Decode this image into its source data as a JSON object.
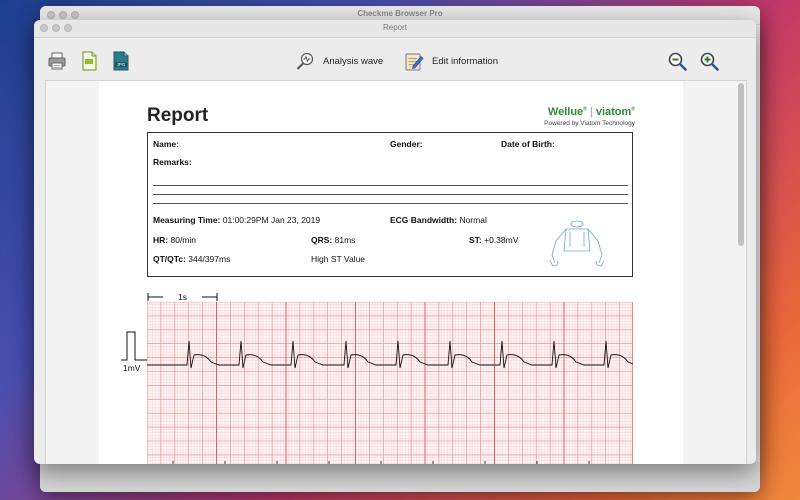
{
  "background_window": {
    "title": "Checkme Browser Pro"
  },
  "window": {
    "title": "Report"
  },
  "toolbar": {
    "print_icon": "printer-icon",
    "pdf_icon": "pdf-file-icon",
    "jpg_icon": "jpg-file-icon",
    "jpg_badge": "JPG",
    "analysis_label": "Analysis wave",
    "edit_label": "Edit information",
    "zoom_out_icon": "zoom-out-icon",
    "zoom_in_icon": "zoom-in-icon"
  },
  "report": {
    "title": "Report",
    "brand": {
      "wellue": "Wellue",
      "separator": "|",
      "viatom": "viatom",
      "powered": "Powered by Viatom Technology"
    },
    "fields": {
      "name_label": "Name:",
      "gender_label": "Gender:",
      "dob_label": "Date of Birth:",
      "remarks_label": "Remarks:",
      "measuring_time_label": "Measuring Time:",
      "measuring_time_value": "01:00:29PM Jan 23, 2019",
      "ecg_bandwidth_label": "ECG Bandwidth:",
      "ecg_bandwidth_value": "Normal",
      "hr_label": "HR:",
      "hr_value": "80/min",
      "qrs_label": "QRS:",
      "qrs_value": "81ms",
      "st_label": "ST:",
      "st_value": "+0.38mV",
      "qt_label": "QT/QTc:",
      "qt_value": "344/397ms",
      "finding": "High ST Value"
    },
    "scale": {
      "time": "1s",
      "amplitude": "1mV"
    }
  },
  "colors": {
    "grid_major": "#e98585",
    "grid_minor": "#f7cccc",
    "waveform": "#111111",
    "brand_green": "#2e8b3e"
  }
}
